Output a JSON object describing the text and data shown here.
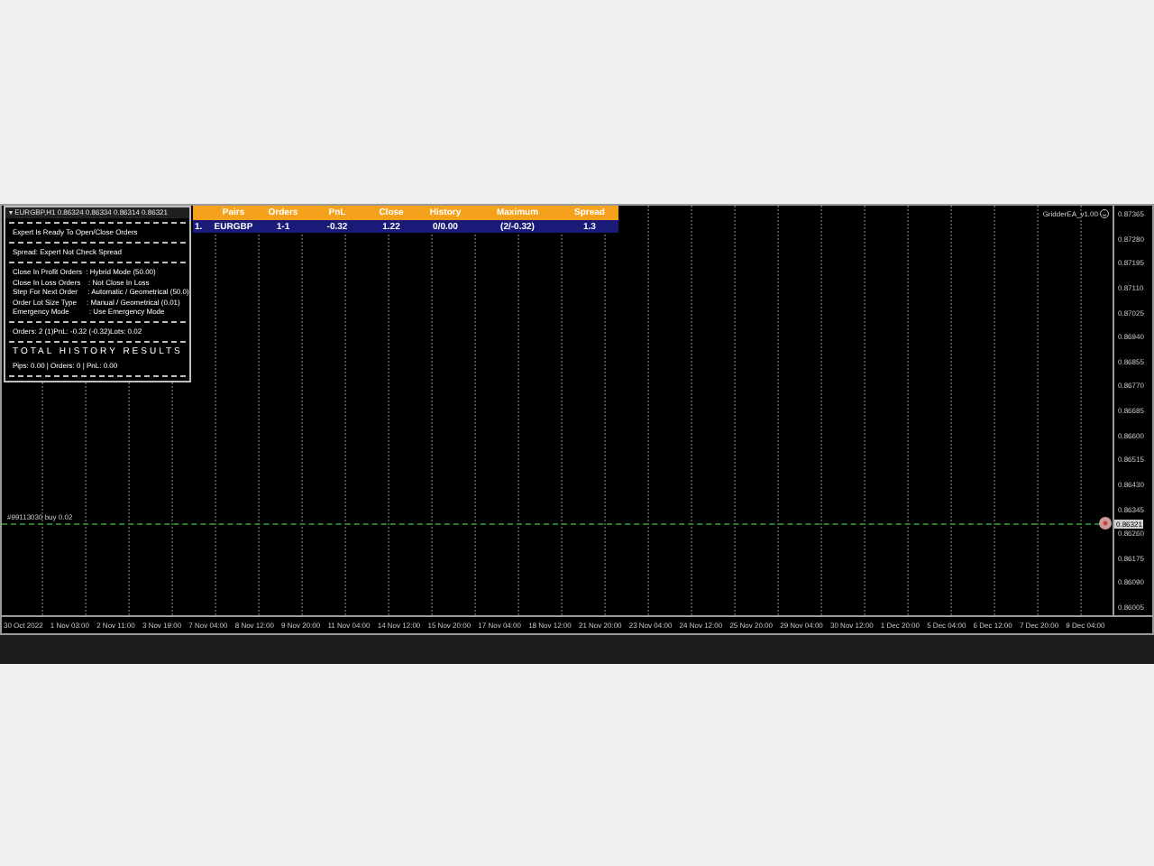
{
  "collapse_marker": "▾",
  "chart_title": "EURGBP,H1  0.86324 0.86334 0.86314 0.86321",
  "info_panel": {
    "status": "Expert Is Ready To Open/Close Orders",
    "spread": "Spread: Expert Not Check Spread",
    "settings": [
      "Close In Profit Orders  : Hybrid Mode (50.00)",
      "Close In Loss Orders    : Not Close In Loss",
      "Step For Next Order     : Automatic / Geometrical (50.0)",
      "Order Lot Size Type     : Manual / Geometrical (0.01)",
      "Emergency Mode          : Use Emergency Mode"
    ],
    "orders": "Orders: 2 (1)PnL: -0.32 (-0.32)Lots: 0.02",
    "history_title": "TOTAL HISTORY RESULTS",
    "history": "Pips: 0.00 | Orders: 0 | PnL: 0.00"
  },
  "pairs_table": {
    "columns": [
      "Pairs",
      "Orders",
      "PnL",
      "Close",
      "History",
      "Maximum",
      "Spread"
    ],
    "rows": [
      {
        "number": "1.",
        "cells": [
          "EURGBP",
          "1-1",
          "-0.32",
          "1.22",
          "0/0.00",
          "(2/-0.32)",
          "1.3"
        ]
      }
    ]
  },
  "expert_label": "GridderEA_v1.00",
  "order_line_label": "#99113030 buy 0.02",
  "price_axis": [
    "0.87365",
    "0.87280",
    "0.87195",
    "0.87110",
    "0.87025",
    "0.86940",
    "0.86855",
    "0.86770",
    "0.86685",
    "0.86600",
    "0.86515",
    "0.86430",
    "0.86345",
    "0.86260",
    "0.86175",
    "0.86090",
    "0.86005"
  ],
  "current_price": "0.86321",
  "time_axis": [
    "30 Oct 2022",
    "1 Nov 03:00",
    "2 Nov 11:00",
    "3 Nov 19:00",
    "7 Nov 04:00",
    "8 Nov 12:00",
    "9 Nov 20:00",
    "11 Nov 04:00",
    "14 Nov 12:00",
    "15 Nov 20:00",
    "17 Nov 04:00",
    "18 Nov 12:00",
    "21 Nov 20:00",
    "23 Nov 04:00",
    "24 Nov 12:00",
    "25 Nov 20:00",
    "29 Nov 04:00",
    "30 Nov 12:00",
    "1 Dec 20:00",
    "5 Dec 04:00",
    "6 Dec 12:00",
    "7 Dec 20:00",
    "9 Dec 04:00"
  ]
}
